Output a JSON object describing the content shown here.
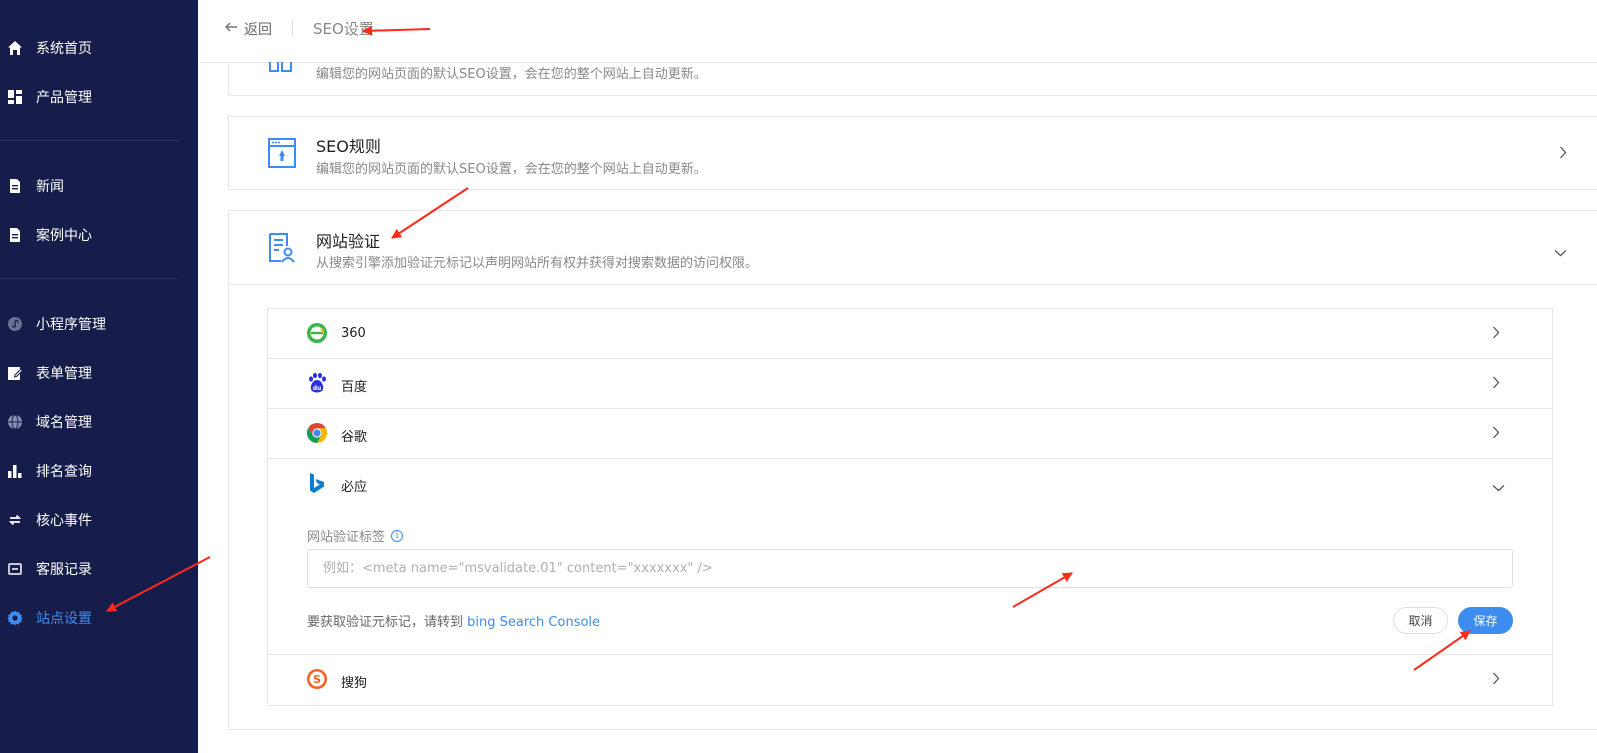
{
  "sidebar": {
    "items": [
      {
        "label": "系统首页",
        "icon": "home-icon"
      },
      {
        "label": "产品管理",
        "icon": "dashboard-icon"
      },
      {
        "label": "新闻",
        "icon": "document-icon"
      },
      {
        "label": "案例中心",
        "icon": "document-icon"
      },
      {
        "label": "小程序管理",
        "icon": "mini-program-icon"
      },
      {
        "label": "表单管理",
        "icon": "form-edit-icon"
      },
      {
        "label": "域名管理",
        "icon": "globe-icon"
      },
      {
        "label": "排名查询",
        "icon": "bar-chart-icon"
      },
      {
        "label": "核心事件",
        "icon": "sync-icon"
      },
      {
        "label": "客服记录",
        "icon": "message-icon"
      },
      {
        "label": "站点设置",
        "icon": "gear-icon",
        "active": true
      }
    ]
  },
  "header": {
    "back_label": "返回",
    "title": "SEO设置"
  },
  "cards": {
    "top_partial": {
      "desc": "编辑您的网站页面的默认SEO设置，会在您的整个网站上自动更新。"
    },
    "seo_rules": {
      "title": "SEO规则",
      "desc": "编辑您的网站页面的默认SEO设置，会在您的整个网站上自动更新。"
    },
    "site_verify": {
      "title": "网站验证",
      "desc": "从搜索引擎添加验证元标记以声明网站所有权并获得对搜索数据的访问权限。"
    }
  },
  "verify": {
    "engines": [
      {
        "label": "360"
      },
      {
        "label": "百度"
      },
      {
        "label": "谷歌"
      },
      {
        "label": "必应"
      },
      {
        "label": "搜狗"
      }
    ],
    "field_label": "网站验证标签",
    "input_placeholder": "例如：<meta name=\"msvalidate.01\" content=\"xxxxxxx\" />",
    "hint_text": "要获取验证元标记，请转到 ",
    "hint_link": "bing Search Console",
    "cancel_label": "取消",
    "save_label": "保存"
  },
  "colors": {
    "sidebar_bg": "#161d4a",
    "accent": "#3d8cf0",
    "annotation_arrow": "#ff2a1a"
  }
}
